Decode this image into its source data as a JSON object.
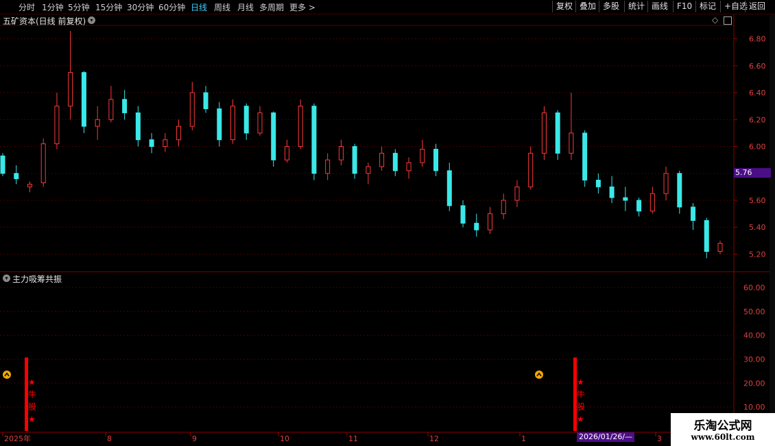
{
  "toolbar": {
    "periods": [
      "分时",
      "1分钟",
      "5分钟",
      "15分钟",
      "30分钟",
      "60分钟",
      "日线",
      "周线",
      "月线",
      "多周期",
      "更多 >"
    ],
    "active_period": "日线",
    "right_buttons": [
      "复权",
      "叠加",
      "多股",
      "统计",
      "画线",
      "F10",
      "标记",
      "+自选",
      "返回"
    ]
  },
  "main_panel": {
    "title": "五矿资本(日线 前复权)",
    "price_axis": [
      "6.80",
      "6.60",
      "6.40",
      "6.20",
      "6.00",
      "5.80",
      "5.60",
      "5.40",
      "5.20"
    ],
    "current_price_label": "5.76"
  },
  "indicator_panel": {
    "title": "主力吸筹共振",
    "axis": [
      "60.00",
      "50.00",
      "40.00",
      "30.00",
      "20.00",
      "10.00"
    ],
    "signal_text": [
      "★",
      "牛",
      "股",
      "★"
    ]
  },
  "x_axis": {
    "labels": [
      "2025年",
      "8",
      "9",
      "10",
      "11",
      "12",
      "1",
      "3"
    ],
    "crosshair_date": "2026/01/26/—"
  },
  "watermark": {
    "name": "乐淘公式网",
    "url": "www.60lt.com"
  },
  "colors": {
    "up": "#ff3a3a",
    "down": "#3ae8e8",
    "grid": "#5a0000",
    "signal": "#ff0000",
    "accent_label": "#4a0e86"
  },
  "chart_data": {
    "type": "candlestick",
    "title": "五矿资本(日线 前复权)",
    "ylim": [
      5.1,
      6.9
    ],
    "x_labels": [
      "2025年",
      "8",
      "9",
      "10",
      "11",
      "12",
      "1",
      "2026/01/26",
      "3"
    ],
    "last_price": 5.76,
    "candles_ohlc": [
      [
        5.93,
        5.95,
        5.78,
        5.8
      ],
      [
        5.8,
        5.86,
        5.72,
        5.76
      ],
      [
        5.7,
        5.74,
        5.66,
        5.72
      ],
      [
        5.73,
        6.06,
        5.7,
        6.02
      ],
      [
        6.02,
        6.4,
        5.98,
        6.3
      ],
      [
        6.3,
        6.86,
        6.2,
        6.55
      ],
      [
        6.55,
        6.56,
        6.1,
        6.15
      ],
      [
        6.15,
        6.3,
        6.05,
        6.2
      ],
      [
        6.2,
        6.45,
        6.18,
        6.35
      ],
      [
        6.35,
        6.42,
        6.2,
        6.25
      ],
      [
        6.25,
        6.3,
        6.0,
        6.05
      ],
      [
        6.05,
        6.1,
        5.95,
        6.0
      ],
      [
        6.0,
        6.1,
        5.96,
        6.05
      ],
      [
        6.05,
        6.2,
        6.0,
        6.15
      ],
      [
        6.15,
        6.48,
        6.12,
        6.4
      ],
      [
        6.4,
        6.45,
        6.25,
        6.28
      ],
      [
        6.28,
        6.33,
        6.0,
        6.05
      ],
      [
        6.05,
        6.35,
        6.02,
        6.3
      ],
      [
        6.3,
        6.32,
        6.05,
        6.1
      ],
      [
        6.1,
        6.3,
        6.08,
        6.25
      ],
      [
        6.25,
        6.26,
        5.85,
        5.9
      ],
      [
        5.9,
        6.05,
        5.88,
        6.0
      ],
      [
        6.0,
        6.35,
        5.98,
        6.3
      ],
      [
        6.3,
        6.32,
        5.75,
        5.8
      ],
      [
        5.8,
        5.95,
        5.75,
        5.9
      ],
      [
        5.9,
        6.05,
        5.86,
        6.0
      ],
      [
        6.0,
        6.02,
        5.76,
        5.8
      ],
      [
        5.8,
        5.88,
        5.72,
        5.85
      ],
      [
        5.85,
        6.0,
        5.82,
        5.95
      ],
      [
        5.95,
        5.98,
        5.78,
        5.82
      ],
      [
        5.82,
        5.92,
        5.76,
        5.88
      ],
      [
        5.88,
        6.05,
        5.85,
        5.98
      ],
      [
        5.98,
        6.02,
        5.78,
        5.82
      ],
      [
        5.82,
        5.88,
        5.52,
        5.56
      ],
      [
        5.56,
        5.6,
        5.4,
        5.43
      ],
      [
        5.43,
        5.5,
        5.33,
        5.38
      ],
      [
        5.38,
        5.55,
        5.35,
        5.5
      ],
      [
        5.5,
        5.65,
        5.46,
        5.6
      ],
      [
        5.6,
        5.75,
        5.55,
        5.7
      ],
      [
        5.7,
        6.0,
        5.68,
        5.95
      ],
      [
        5.95,
        6.3,
        5.9,
        6.25
      ],
      [
        6.25,
        6.27,
        5.9,
        5.95
      ],
      [
        5.95,
        6.4,
        5.9,
        6.1
      ],
      [
        6.1,
        6.12,
        5.7,
        5.75
      ],
      [
        5.75,
        5.8,
        5.65,
        5.7
      ],
      [
        5.7,
        5.78,
        5.58,
        5.62
      ],
      [
        5.62,
        5.7,
        5.52,
        5.6
      ],
      [
        5.6,
        5.62,
        5.48,
        5.52
      ],
      [
        5.52,
        5.7,
        5.5,
        5.65
      ],
      [
        5.65,
        5.85,
        5.6,
        5.8
      ],
      [
        5.8,
        5.82,
        5.5,
        5.55
      ],
      [
        5.55,
        5.58,
        5.38,
        5.45
      ],
      [
        5.45,
        5.47,
        5.17,
        5.22
      ],
      [
        5.22,
        5.3,
        5.2,
        5.28
      ]
    ]
  },
  "indicator_data": {
    "type": "bar",
    "signals_at": [
      "2025年7月初",
      "2026/01/26"
    ],
    "signal_text": "★牛股★"
  }
}
